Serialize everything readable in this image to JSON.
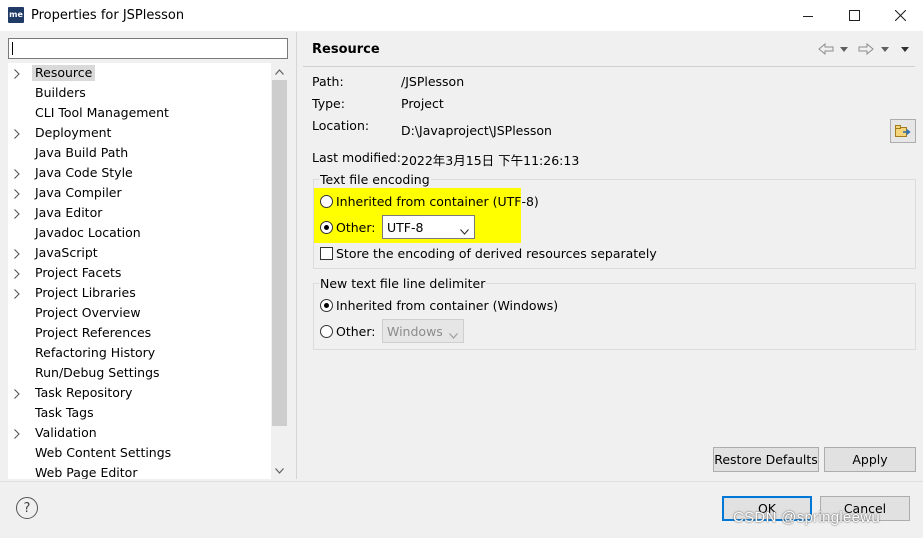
{
  "window": {
    "app_icon_text": "me",
    "title": "Properties for JSPlesson"
  },
  "sidebar": {
    "filter_value": "",
    "items": [
      {
        "label": "Resource",
        "expandable": true,
        "selected": true
      },
      {
        "label": "Builders",
        "expandable": false
      },
      {
        "label": "CLI Tool Management",
        "expandable": false
      },
      {
        "label": "Deployment",
        "expandable": true
      },
      {
        "label": "Java Build Path",
        "expandable": false
      },
      {
        "label": "Java Code Style",
        "expandable": true
      },
      {
        "label": "Java Compiler",
        "expandable": true
      },
      {
        "label": "Java Editor",
        "expandable": true
      },
      {
        "label": "Javadoc Location",
        "expandable": false
      },
      {
        "label": "JavaScript",
        "expandable": true
      },
      {
        "label": "Project Facets",
        "expandable": true
      },
      {
        "label": "Project Libraries",
        "expandable": true
      },
      {
        "label": "Project Overview",
        "expandable": false
      },
      {
        "label": "Project References",
        "expandable": false
      },
      {
        "label": "Refactoring History",
        "expandable": false
      },
      {
        "label": "Run/Debug Settings",
        "expandable": false
      },
      {
        "label": "Task Repository",
        "expandable": true
      },
      {
        "label": "Task Tags",
        "expandable": false
      },
      {
        "label": "Validation",
        "expandable": true
      },
      {
        "label": "Web Content Settings",
        "expandable": false
      },
      {
        "label": "Web Page Editor",
        "expandable": false
      }
    ]
  },
  "main": {
    "title": "Resource",
    "path_label": "Path:",
    "path_value": "/JSPlesson",
    "type_label": "Type:",
    "type_value": "Project",
    "location_label": "Location:",
    "location_value": "D:\\Javaproject\\JSPlesson",
    "modified_label": "Last modified:",
    "modified_value": "2022年3月15日 下午11:26:13",
    "encoding": {
      "group_title": "Text file encoding",
      "inherited_label": "Inherited from container (UTF-8)",
      "other_label": "Other:",
      "other_value": "UTF-8",
      "selected": "other",
      "derived_label": "Store the encoding of derived resources separately",
      "derived_checked": false
    },
    "delimiter": {
      "group_title": "New text file line delimiter",
      "inherited_label": "Inherited from container (Windows)",
      "other_label": "Other:",
      "other_value": "Windows",
      "selected": "inherited"
    },
    "restore_defaults_label": "Restore Defaults",
    "apply_label": "Apply"
  },
  "footer": {
    "help_symbol": "?",
    "ok_label": "OK",
    "cancel_label": "Cancel",
    "watermark": "CSDN @springleewu"
  },
  "colors": {
    "highlight": "#ffff00",
    "default_button_border": "#0078d7",
    "selected_item_bg": "#d9d9d9"
  }
}
